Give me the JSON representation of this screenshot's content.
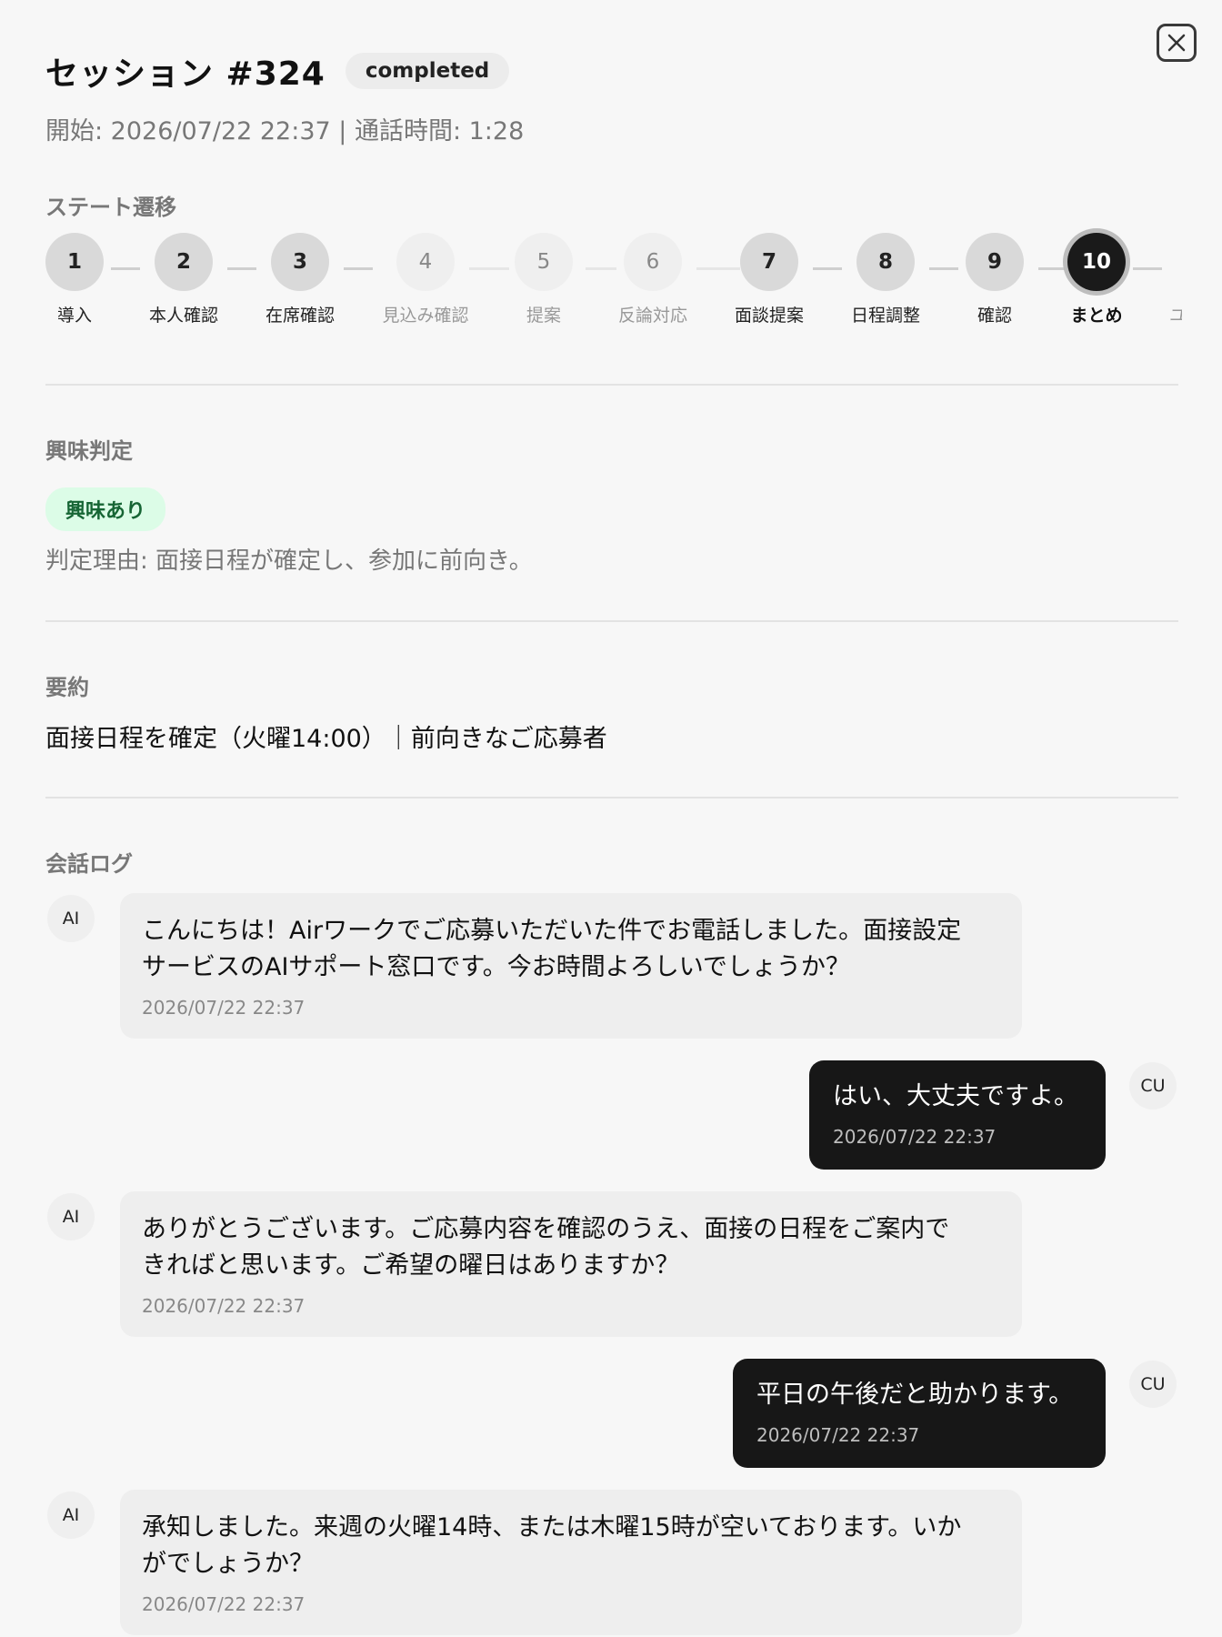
{
  "header": {
    "title": "セッション #324",
    "status": "completed",
    "meta": "開始: 2026/07/22 22:37 | 通話時間: 1:28"
  },
  "state_transition": {
    "section_title": "ステート遷移",
    "steps": [
      {
        "num": "1",
        "label": "導入",
        "state": "done"
      },
      {
        "num": "2",
        "label": "本人確認",
        "state": "done"
      },
      {
        "num": "3",
        "label": "在席確認",
        "state": "done"
      },
      {
        "num": "4",
        "label": "見込み確認",
        "state": "skipped"
      },
      {
        "num": "5",
        "label": "提案",
        "state": "skipped"
      },
      {
        "num": "6",
        "label": "反論対応",
        "state": "skipped"
      },
      {
        "num": "7",
        "label": "面談提案",
        "state": "done"
      },
      {
        "num": "8",
        "label": "日程調整",
        "state": "done"
      },
      {
        "num": "9",
        "label": "確認",
        "state": "done"
      },
      {
        "num": "10",
        "label": "まとめ",
        "state": "current"
      },
      {
        "num": "",
        "label": "ユ",
        "state": "next"
      }
    ]
  },
  "interest": {
    "section_title": "興味判定",
    "badge": "興味あり",
    "reason": "判定理由: 面接日程が確定し、参加に前向き。"
  },
  "summary": {
    "section_title": "要約",
    "text": "面接日程を確定（火曜14:00）｜前向きなご応募者"
  },
  "conversation": {
    "section_title": "会話ログ",
    "messages": [
      {
        "role": "AI",
        "text": "こんにちは！Airワークでご応募いただいた件でお電話しました。面接設定\nサービスのAIサポート窓口です。今お時間よろしいでしょうか？",
        "time": "2026/07/22 22:37"
      },
      {
        "role": "CU",
        "text": "はい、大丈夫ですよ。",
        "time": "2026/07/22 22:37"
      },
      {
        "role": "AI",
        "text": "ありがとうございます。ご応募内容を確認のうえ、面接の日程をご案内で\nきればと思います。ご希望の曜日はありますか？",
        "time": "2026/07/22 22:37"
      },
      {
        "role": "CU",
        "text": "平日の午後だと助かります。",
        "time": "2026/07/22 22:37"
      },
      {
        "role": "AI",
        "text": "承知しました。来週の火曜14時、または木曜15時が空いております。いか\nがでしょうか？",
        "time": "2026/07/22 22:37"
      }
    ]
  },
  "colors": {
    "current_step": "#1a1a1a",
    "interest_badge_bg": "#dcfce7",
    "interest_badge_text": "#166534",
    "customer_bubble": "#171717"
  },
  "icons": {
    "close": "close-icon"
  }
}
